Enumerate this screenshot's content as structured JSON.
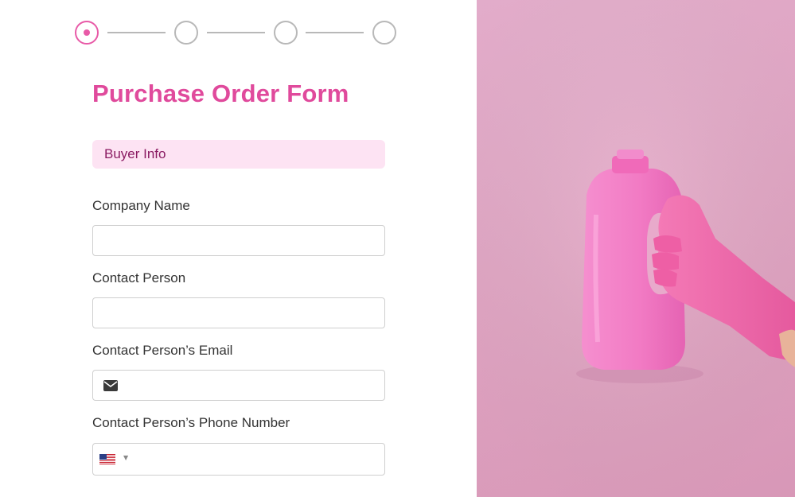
{
  "stepper": {
    "steps": 4,
    "active_step": 1
  },
  "form": {
    "title": "Purchase Order Form",
    "section": "Buyer Info",
    "fields": {
      "company_name": {
        "label": "Company Name",
        "value": ""
      },
      "contact_person": {
        "label": "Contact Person",
        "value": ""
      },
      "email": {
        "label": "Contact Person’s Email",
        "value": "",
        "icon": "mail-icon"
      },
      "phone": {
        "label": "Contact Person’s Phone Number",
        "value": "",
        "country": "US",
        "icon": "us-flag-icon"
      }
    }
  },
  "colors": {
    "accent": "#e04a9c",
    "section_bg": "#fde3f3",
    "section_text": "#8a1a62",
    "image_bg": "#eab6d2",
    "bottle": "#f27bc4",
    "glove": "#f065a8"
  },
  "image": {
    "subject": "pink detergent bottle held by gloved hand"
  }
}
